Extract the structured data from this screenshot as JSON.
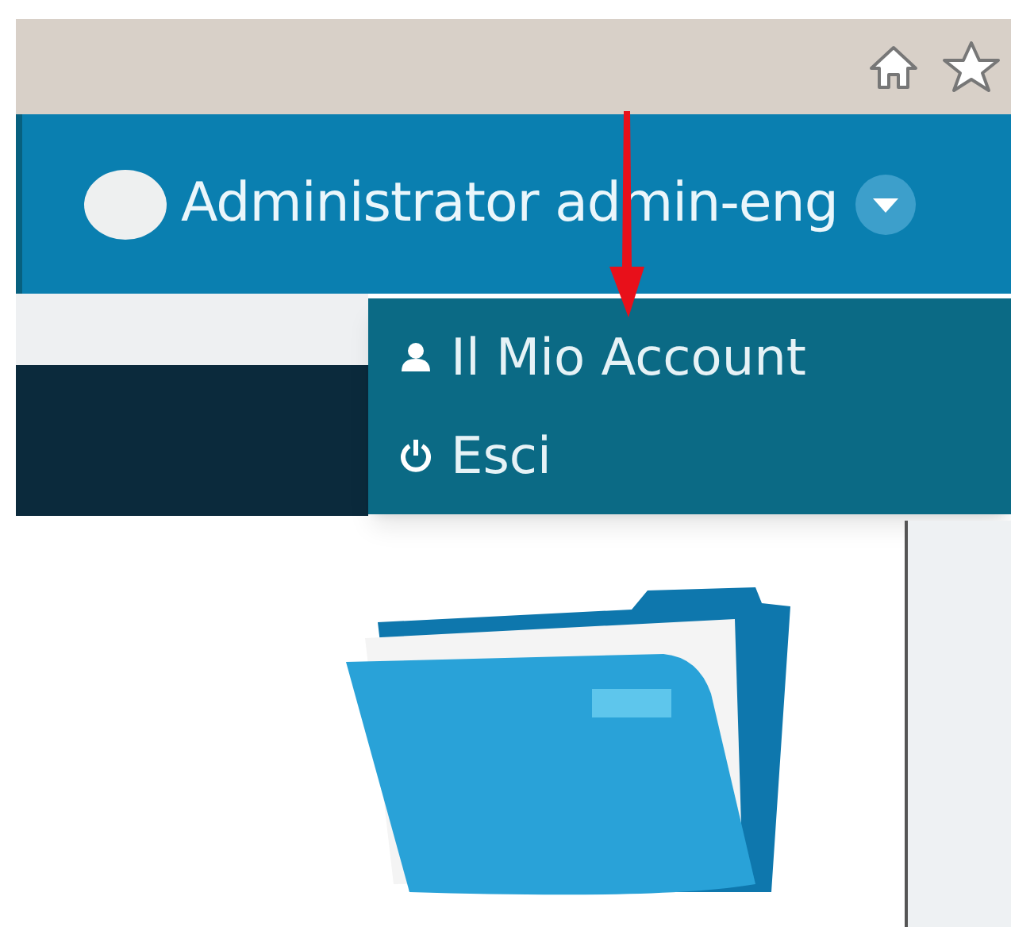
{
  "header": {
    "user_name": "Administrator admin-eng"
  },
  "menu": {
    "items": [
      {
        "kind": "account",
        "label": "Il Mio Account"
      },
      {
        "kind": "logout",
        "label": "Esci"
      }
    ]
  }
}
